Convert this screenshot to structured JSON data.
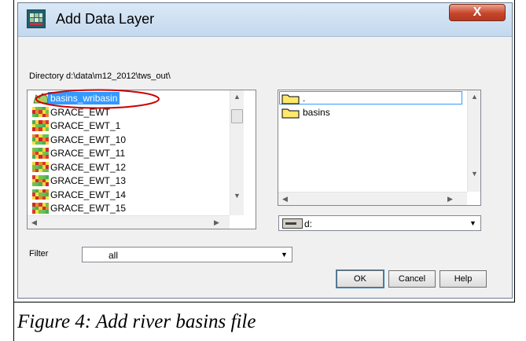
{
  "window": {
    "title": "Add Data Layer",
    "close_glyph": "X",
    "directory_label": "Directory d:\\data\\m12_2012\\tws_out\\"
  },
  "layers": {
    "items": [
      {
        "label": "basins_wribasin",
        "icon": "basin-shape-icon",
        "selected": true
      },
      {
        "label": "GRACE_EWT",
        "icon": "grid-layer-icon"
      },
      {
        "label": "GRACE_EWT_1",
        "icon": "grid-layer-icon"
      },
      {
        "label": "GRACE_EWT_10",
        "icon": "grid-layer-icon"
      },
      {
        "label": "GRACE_EWT_11",
        "icon": "grid-layer-icon"
      },
      {
        "label": "GRACE_EWT_12",
        "icon": "grid-layer-icon"
      },
      {
        "label": "GRACE_EWT_13",
        "icon": "grid-layer-icon"
      },
      {
        "label": "GRACE_EWT_14",
        "icon": "grid-layer-icon"
      },
      {
        "label": "GRACE_EWT_15",
        "icon": "grid-layer-icon"
      }
    ]
  },
  "folders": {
    "items": [
      {
        "label": ".",
        "icon": "folder-icon"
      },
      {
        "label": "basins",
        "icon": "folder-icon"
      }
    ]
  },
  "drive": {
    "value": "d:",
    "icon": "drive-icon"
  },
  "filter": {
    "label": "Filter",
    "value": "all"
  },
  "buttons": {
    "ok": "OK",
    "cancel": "Cancel",
    "help": "Help"
  },
  "caption": "Figure 4: Add river basins file",
  "colors": {
    "selection": "#3399ff",
    "annotation_ellipse": "#cc0000",
    "close_button": "#c6452b"
  }
}
